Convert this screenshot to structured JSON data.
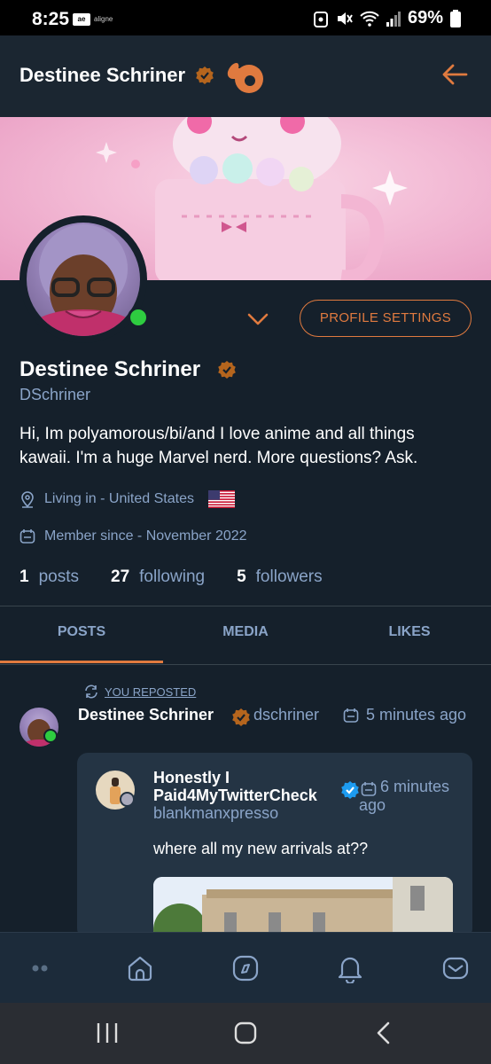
{
  "status_bar": {
    "time": "8:25",
    "app_icon_text": "ae",
    "carrier": "aligne",
    "battery": "69%"
  },
  "header": {
    "title": "Destinee Schriner"
  },
  "profile": {
    "profile_settings_label": "PROFILE SETTINGS",
    "name": "Destinee Schriner",
    "handle": "DSchriner",
    "bio": "Hi, Im polyamorous/bi/and I love anime and all things kawaii. I'm a huge Marvel nerd. More questions? Ask.",
    "living": "Living in - United States",
    "member_since": "Member since - November 2022",
    "stats": {
      "posts_count": "1",
      "posts_label": "posts",
      "following_count": "27",
      "following_label": "following",
      "followers_count": "5",
      "followers_label": "followers"
    }
  },
  "tabs": {
    "posts": "POSTS",
    "media": "MEDIA",
    "likes": "LIKES",
    "active": "POSTS"
  },
  "post": {
    "reposted_label": "YOU REPOSTED",
    "author": "Destinee Schriner",
    "handle": "dschriner",
    "time": "5 minutes ago",
    "quote": {
      "author": "Honestly I Paid4MyTwitterCheck",
      "handle": "blankmanxpresso",
      "time": "6 minutes ago",
      "text": "where all my new arrivals at??"
    }
  },
  "colors": {
    "accent": "#e07a3f",
    "background": "#15202b",
    "muted": "#8aa4c8",
    "online": "#2ecc40",
    "verified": "#1d9bf0"
  },
  "icons": {
    "nav": [
      "more-icon",
      "home-icon",
      "explore-icon",
      "notifications-icon",
      "messages-icon"
    ],
    "system": [
      "recent-apps-icon",
      "home-button-icon",
      "back-button-icon"
    ]
  }
}
